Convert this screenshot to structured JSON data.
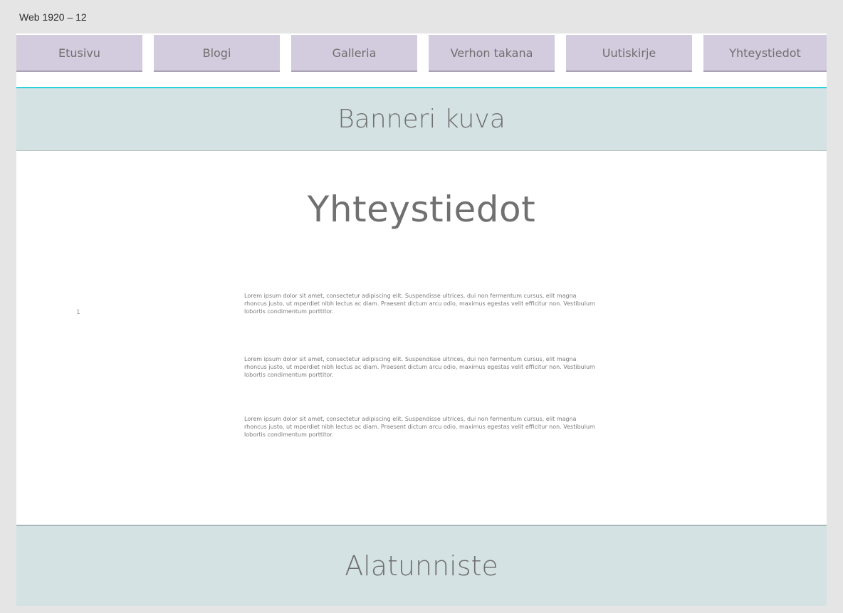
{
  "frame": {
    "label": "Web 1920 – 12"
  },
  "nav": {
    "items": [
      {
        "label": "Etusivu"
      },
      {
        "label": "Blogi"
      },
      {
        "label": "Galleria"
      },
      {
        "label": "Verhon takana"
      },
      {
        "label": "Uutiskirje"
      },
      {
        "label": "Yhteystiedot"
      }
    ]
  },
  "banner": {
    "text": "Banneri kuva"
  },
  "content": {
    "title": "Yhteystiedot",
    "side_number": "1",
    "paragraphs": [
      "Lorem ipsum dolor sit amet, consectetur adipiscing elit. Suspendisse ultrices, dui non fermentum cursus, elit magna rhoncus justo, ut mperdiet nibh lectus ac diam. Praesent dictum arcu odio, maximus egestas velit efficitur non. Vestibulum lobortis condimentum porttitor.",
      "Lorem ipsum dolor sit amet, consectetur adipiscing elit. Suspendisse ultrices, dui non fermentum cursus, elit magna rhoncus justo, ut mperdiet nibh lectus ac diam. Praesent dictum arcu odio, maximus egestas velit efficitur non. Vestibulum lobortis condimentum porttitor.",
      "Lorem ipsum dolor sit amet, consectetur adipiscing elit. Suspendisse ultrices, dui non fermentum cursus, elit magna rhoncus justo, ut mperdiet nibh lectus ac diam. Praesent dictum arcu odio, maximus egestas velit efficitur non. Vestibulum lobortis condimentum porttitor."
    ]
  },
  "footer": {
    "text": "Alatunniste"
  },
  "colors": {
    "canvas_bg": "#e5e5e5",
    "nav_bg": "#d3cbde",
    "banner_bg": "#d4e2e4",
    "banner_accent": "#29d3dc",
    "footer_bg": "#d4e2e4",
    "text": "#707070"
  }
}
